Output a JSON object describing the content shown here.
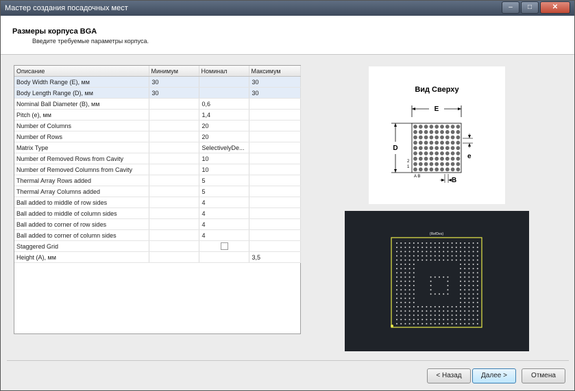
{
  "window": {
    "title": "Мастер создания посадочных мест"
  },
  "header": {
    "title": "Размеры корпуса BGA",
    "subtitle": "Введите требуемые параметры корпуса."
  },
  "grid": {
    "columns": [
      "Описание",
      "Минимум",
      "Номинал",
      "Максимум"
    ],
    "rows": [
      [
        "Body Width Range (E), мм",
        "30",
        "",
        "30"
      ],
      [
        "Body Length Range (D), мм",
        "30",
        "",
        "30"
      ],
      [
        "Nominal Ball Diameter (B), мм",
        "",
        "0,6",
        ""
      ],
      [
        "Pitch (e), мм",
        "",
        "1,4",
        ""
      ],
      [
        "Number of Columns",
        "",
        "20",
        ""
      ],
      [
        "Number of Rows",
        "",
        "20",
        ""
      ],
      [
        "Matrix Type",
        "",
        "SelectivelyDe...",
        ""
      ],
      [
        "Number of Removed Rows from Cavity",
        "",
        "10",
        ""
      ],
      [
        "Number of Removed Columns from Cavity",
        "",
        "10",
        ""
      ],
      [
        "Thermal Array Rows added",
        "",
        "5",
        ""
      ],
      [
        "Thermal Array Columns added",
        "",
        "5",
        ""
      ],
      [
        "Ball added to middle of row sides",
        "",
        "4",
        ""
      ],
      [
        "Ball added to middle of column sides",
        "",
        "4",
        ""
      ],
      [
        "Ball added to corner of row sides",
        "",
        "4",
        ""
      ],
      [
        "Ball added to corner of column sides",
        "",
        "4",
        ""
      ],
      [
        "Staggered Grid",
        "",
        "",
        ""
      ],
      [
        "Height (A), мм",
        "",
        "",
        "3,5"
      ]
    ],
    "staggered_checked": false
  },
  "diagram": {
    "title": "Вид Сверху",
    "label_E": "E",
    "label_D": "D",
    "label_e": "e",
    "label_B": "B",
    "label_AB": "A B",
    "label_2": "2",
    "label_1": "1"
  },
  "preview": {
    "label": "{RefDes}",
    "outline_color": "#e8e84a",
    "pad_color": "#d8d8d8"
  },
  "buttons": {
    "back": "< Назад",
    "next": "Далее >",
    "cancel": "Отмена"
  },
  "titlebar_buttons": {
    "min": "–",
    "max": "□",
    "close": "✕"
  }
}
